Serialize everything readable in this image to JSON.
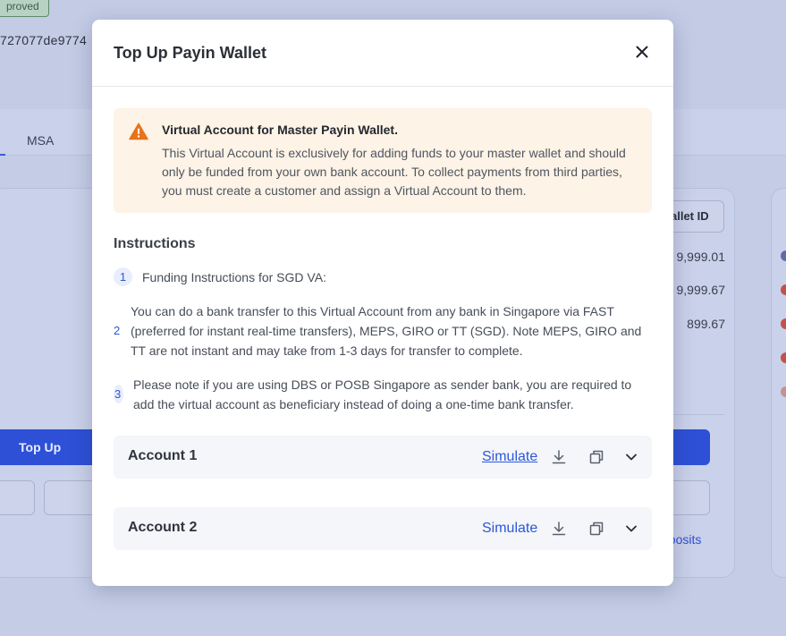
{
  "background": {
    "badge": "proved",
    "hash": "727077de9774",
    "tab_label": "MSA",
    "wallet_id_button": "allet ID",
    "amounts": [
      "9,999.01",
      "9,999.67",
      "899.67"
    ],
    "topup_button": "Top Up",
    "deposits_link": "eposits"
  },
  "modal": {
    "title": "Top Up Payin Wallet",
    "alert": {
      "title": "Virtual Account for Master Payin Wallet.",
      "body": "This Virtual Account is exclusively for adding funds to your master wallet and should only be funded from your own bank account. To collect payments from third parties, you must create a customer and assign a Virtual Account to them."
    },
    "instructions_title": "Instructions",
    "steps": [
      {
        "num": "1",
        "text": "Funding Instructions for SGD VA:"
      },
      {
        "num": "2",
        "text": "You can do a bank transfer to this Virtual Account from any bank in Singapore via FAST (preferred for instant real-time transfers), MEPS, GIRO or TT (SGD). Note MEPS, GIRO and TT are not instant and may take from 1-3 days for transfer to complete."
      },
      {
        "num": "3",
        "text": "Please note if you are using DBS or POSB Singapore as sender bank, you are required to add the virtual account as beneficiary instead of doing a one-time bank transfer."
      }
    ],
    "accounts": [
      {
        "label": "Account 1",
        "simulate": "Simulate"
      },
      {
        "label": "Account 2",
        "simulate": "Simulate"
      }
    ]
  },
  "colors": {
    "accent": "#2d57d8",
    "alert_bg": "#fdf3e6",
    "warning_icon": "#e8731a",
    "overlay": "#c5cde6"
  },
  "icons": {
    "close": "close-icon",
    "warning": "warning-triangle-icon",
    "download": "download-icon",
    "copy": "copy-icon",
    "expand": "chevron-down-icon"
  }
}
